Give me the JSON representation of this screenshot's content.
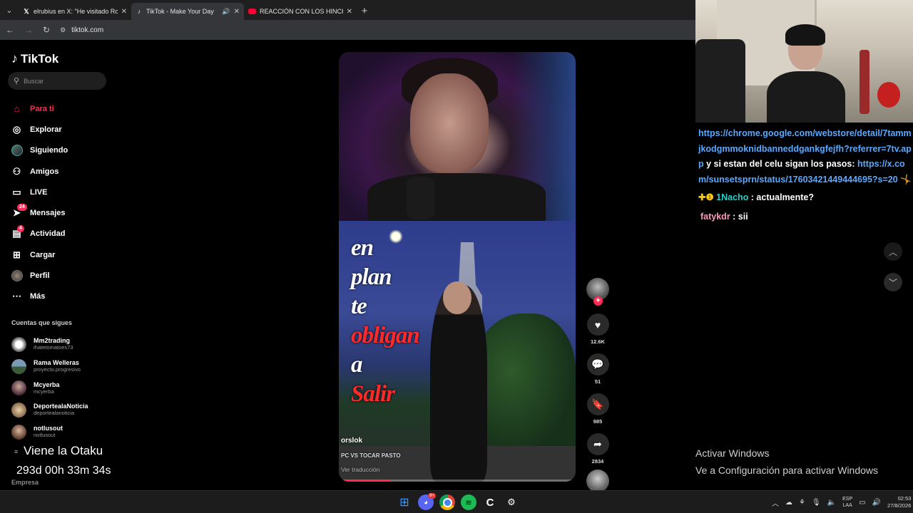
{
  "browser": {
    "tabs": [
      {
        "title": "elrubius en X: \"He visitado Roc",
        "icon": "x-icon"
      },
      {
        "title": "TikTok - Make Your Day",
        "icon": "tiktok-icon",
        "active": true
      },
      {
        "title": "REACCIÓN CON LOS HINCHAS",
        "icon": "youtube-icon"
      }
    ],
    "url": "tiktok.com"
  },
  "tiktok": {
    "logo": "TikTok",
    "search_placeholder": "Buscar",
    "nav": [
      {
        "label": "Para ti",
        "icon": "home-icon",
        "active": true
      },
      {
        "label": "Explorar",
        "icon": "compass-icon"
      },
      {
        "label": "Siguiendo",
        "icon": "following-icon"
      },
      {
        "label": "Amigos",
        "icon": "friends-icon"
      },
      {
        "label": "LIVE",
        "icon": "live-icon"
      },
      {
        "label": "Mensajes",
        "icon": "messages-icon",
        "badge": "24"
      },
      {
        "label": "Actividad",
        "icon": "activity-icon",
        "badge": "4"
      },
      {
        "label": "Cargar",
        "icon": "upload-icon"
      },
      {
        "label": "Perfil",
        "icon": "profile-icon"
      },
      {
        "label": "Más",
        "icon": "more-icon"
      }
    ],
    "following_title": "Cuentas que sigues",
    "following": [
      {
        "name": "Mm2trading",
        "handle": "ihatetomatoes73",
        "color": "#dddddd"
      },
      {
        "name": "Rama Welleras",
        "handle": "proyecto.progresivo",
        "color": "#6a8aa8"
      },
      {
        "name": "Mcyerba",
        "handle": "mcyerba",
        "color": "#8a6a7a"
      },
      {
        "name": "DeportealaNoticia",
        "handle": "deportealanoticia",
        "color": "#b89a7a"
      },
      {
        "name": "notlusout",
        "handle": "notlusout",
        "color": "#c0a090"
      }
    ],
    "company": "Empresa",
    "overlay_title": "Viene la Otaku",
    "overlay_timer": "293d 00h 33m 34s",
    "video": {
      "caption_lines": [
        {
          "text": "en",
          "red": false
        },
        {
          "text": "plan",
          "red": false
        },
        {
          "text": "te",
          "red": false
        },
        {
          "text": "obligan",
          "red": true
        },
        {
          "text": "a",
          "red": false
        },
        {
          "text": "Salir",
          "red": true
        }
      ],
      "author": "orslok",
      "description": "PC VS TOCAR PASTO",
      "translate": "Ver traducción",
      "progress": 0.22
    },
    "actions": {
      "likes": "12.6K",
      "comments": "51",
      "saves": "985",
      "shares": "2834"
    }
  },
  "stream": {
    "chat": {
      "link1": "https://chrome.google.com/webstore/detail/7tammjkodgmmoknidbanneddgankgfejfh?referrer=7tv.app",
      "text1": " y si estan del celu sigan los pasos: ",
      "link2": "https://x.com/sunsetsprn/status/17603421449444695?s=20",
      "emoji1": "🤸",
      "user2_badges": "✚❶",
      "user2": "1Nacho",
      "msg2": " : actualmente?",
      "user3": "fatykdr",
      "msg3": " : sii"
    },
    "windows_activation": {
      "line1": "Activar Windows",
      "line2": "Ve a Configuración para activar Windows"
    }
  },
  "taskbar": {
    "discord_badge": "9+",
    "lang_line1": "ESP",
    "lang_line2": "LAA",
    "time": "02:53",
    "date": "27/8/2026"
  }
}
